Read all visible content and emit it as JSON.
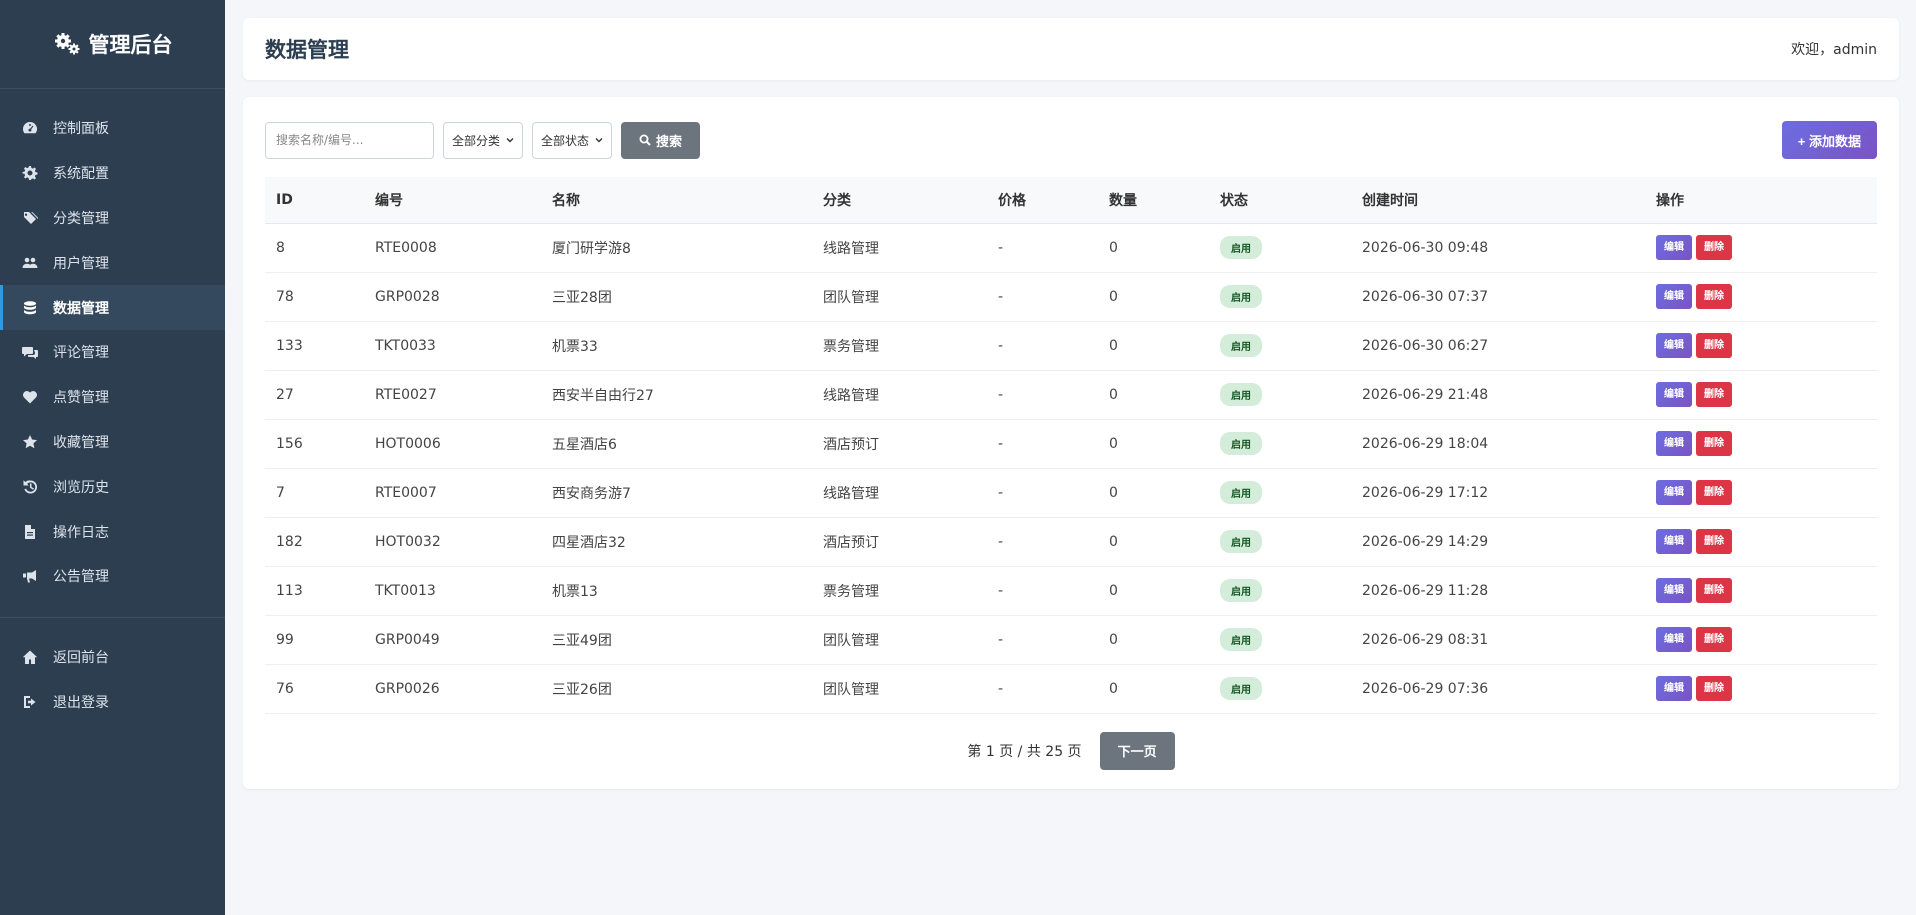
{
  "app": {
    "brand": "管理后台"
  },
  "sidebar": {
    "items": [
      {
        "label": "控制面板",
        "icon": "dashboard-icon"
      },
      {
        "label": "系统配置",
        "icon": "gear-icon"
      },
      {
        "label": "分类管理",
        "icon": "tags-icon"
      },
      {
        "label": "用户管理",
        "icon": "users-icon"
      },
      {
        "label": "数据管理",
        "icon": "database-icon",
        "active": true
      },
      {
        "label": "评论管理",
        "icon": "comments-icon"
      },
      {
        "label": "点赞管理",
        "icon": "heart-icon"
      },
      {
        "label": "收藏管理",
        "icon": "star-icon"
      },
      {
        "label": "浏览历史",
        "icon": "history-icon"
      },
      {
        "label": "操作日志",
        "icon": "file-icon"
      },
      {
        "label": "公告管理",
        "icon": "bullhorn-icon"
      }
    ],
    "bottom": [
      {
        "label": "返回前台",
        "icon": "home-icon"
      },
      {
        "label": "退出登录",
        "icon": "logout-icon"
      }
    ]
  },
  "header": {
    "title": "数据管理",
    "welcome": "欢迎，admin"
  },
  "toolbar": {
    "search_placeholder": "搜索名称/编号...",
    "category_select": "全部分类",
    "status_select": "全部状态",
    "search_label": "搜索",
    "add_label": "+ 添加数据"
  },
  "table": {
    "headers": [
      "ID",
      "编号",
      "名称",
      "分类",
      "价格",
      "数量",
      "状态",
      "创建时间",
      "操作"
    ],
    "edit_label": "编辑",
    "delete_label": "删除",
    "rows": [
      {
        "id": "8",
        "code": "RTE0008",
        "name": "厦门研学游8",
        "category": "线路管理",
        "price": "-",
        "qty": "0",
        "status": "启用",
        "created": "2026-06-30 09:48"
      },
      {
        "id": "78",
        "code": "GRP0028",
        "name": "三亚28团",
        "category": "团队管理",
        "price": "-",
        "qty": "0",
        "status": "启用",
        "created": "2026-06-30 07:37"
      },
      {
        "id": "133",
        "code": "TKT0033",
        "name": "机票33",
        "category": "票务管理",
        "price": "-",
        "qty": "0",
        "status": "启用",
        "created": "2026-06-30 06:27"
      },
      {
        "id": "27",
        "code": "RTE0027",
        "name": "西安半自由行27",
        "category": "线路管理",
        "price": "-",
        "qty": "0",
        "status": "启用",
        "created": "2026-06-29 21:48"
      },
      {
        "id": "156",
        "code": "HOT0006",
        "name": "五星酒店6",
        "category": "酒店预订",
        "price": "-",
        "qty": "0",
        "status": "启用",
        "created": "2026-06-29 18:04"
      },
      {
        "id": "7",
        "code": "RTE0007",
        "name": "西安商务游7",
        "category": "线路管理",
        "price": "-",
        "qty": "0",
        "status": "启用",
        "created": "2026-06-29 17:12"
      },
      {
        "id": "182",
        "code": "HOT0032",
        "name": "四星酒店32",
        "category": "酒店预订",
        "price": "-",
        "qty": "0",
        "status": "启用",
        "created": "2026-06-29 14:29"
      },
      {
        "id": "113",
        "code": "TKT0013",
        "name": "机票13",
        "category": "票务管理",
        "price": "-",
        "qty": "0",
        "status": "启用",
        "created": "2026-06-29 11:28"
      },
      {
        "id": "99",
        "code": "GRP0049",
        "name": "三亚49团",
        "category": "团队管理",
        "price": "-",
        "qty": "0",
        "status": "启用",
        "created": "2026-06-29 08:31"
      },
      {
        "id": "76",
        "code": "GRP0026",
        "name": "三亚26团",
        "category": "团队管理",
        "price": "-",
        "qty": "0",
        "status": "启用",
        "created": "2026-06-29 07:36"
      }
    ]
  },
  "pager": {
    "info": "第 1 页 / 共 25 页",
    "next_label": "下一页"
  },
  "colors": {
    "sidebar_bg": "#2c3e50",
    "accent": "#3498db",
    "primary_gradient": "#6c6ee0",
    "danger": "#dc3545",
    "status_bg": "#d4edda"
  }
}
